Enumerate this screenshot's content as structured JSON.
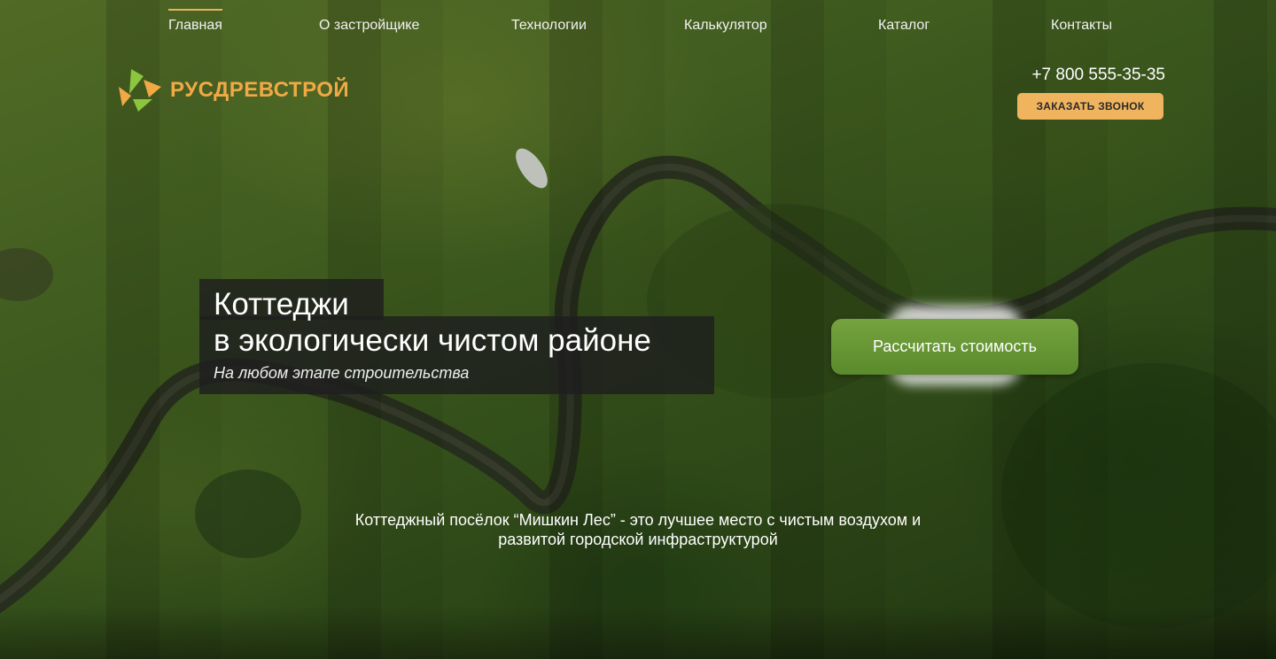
{
  "nav": {
    "items": [
      {
        "label": "Главная",
        "active": true
      },
      {
        "label": "О застройщике"
      },
      {
        "label": "Технологии"
      },
      {
        "label": "Калькулятор"
      },
      {
        "label": "Каталог"
      },
      {
        "label": "Контакты"
      }
    ]
  },
  "brand": {
    "name": "РУСДРЕВСТРОЙ",
    "logo_icon": "leaf-logo-icon"
  },
  "contact": {
    "phone": "+7 800 555-35-35",
    "callback_label": "ЗАКАЗАТЬ ЗВОНОК"
  },
  "hero": {
    "title_line1": "Коттеджи",
    "title_line2": "в экологически чистом районе",
    "subtitle": "На любом этапе строительства",
    "cta_label": "Рассчитать стоимость"
  },
  "description": {
    "line1": "Коттеджный посёлок “Мишкин Лес” - это лучшее место с чистым воздухом и",
    "line2": "развитой городской инфраструктурой"
  },
  "colors": {
    "accent": "#f0b45e",
    "brand_orange": "#f0a945",
    "cta_green": "#6a9a36"
  }
}
